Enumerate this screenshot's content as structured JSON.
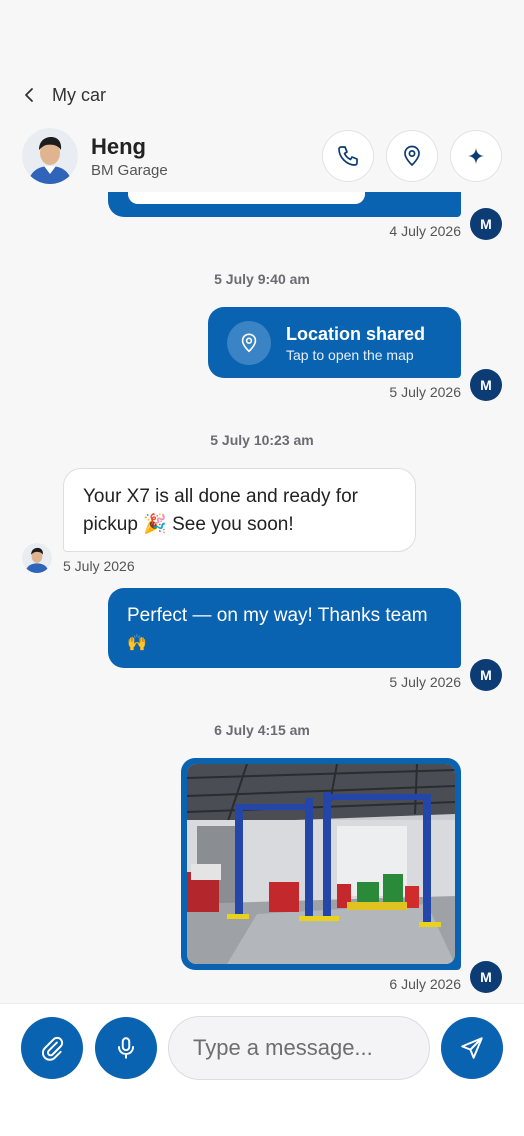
{
  "header": {
    "back_label": "My car",
    "contact_name": "Heng",
    "contact_sub": "BM Garage",
    "actions": [
      "phone-icon",
      "location-pin-icon",
      "sparkle-icon"
    ]
  },
  "messages": {
    "first_stamp": "4 July 2026",
    "sep1": "5 July 9:40 am",
    "location_title": "Location shared",
    "location_sub": "Tap to open the map",
    "location_stamp": "5 July 2026",
    "sep2": "5 July 10:23 am",
    "incoming_line1": "Your X7 is all done and ready for",
    "incoming_line2": "pickup 🎉 See you soon!",
    "incoming_stamp": "5 July 2026",
    "outgoing_line1": "Perfect — on my way! Thanks team",
    "outgoing_line2": "🙌",
    "outgoing_stamp": "5 July 2026",
    "sep3": "6 July 4:15 am",
    "photo_stamp": "6 July 2026",
    "me_initial": "M"
  },
  "composer": {
    "placeholder": "Type a message..."
  },
  "colors": {
    "accent": "#0a63b0",
    "me_avatar": "#0d3b73",
    "background": "#f7f7f8"
  }
}
